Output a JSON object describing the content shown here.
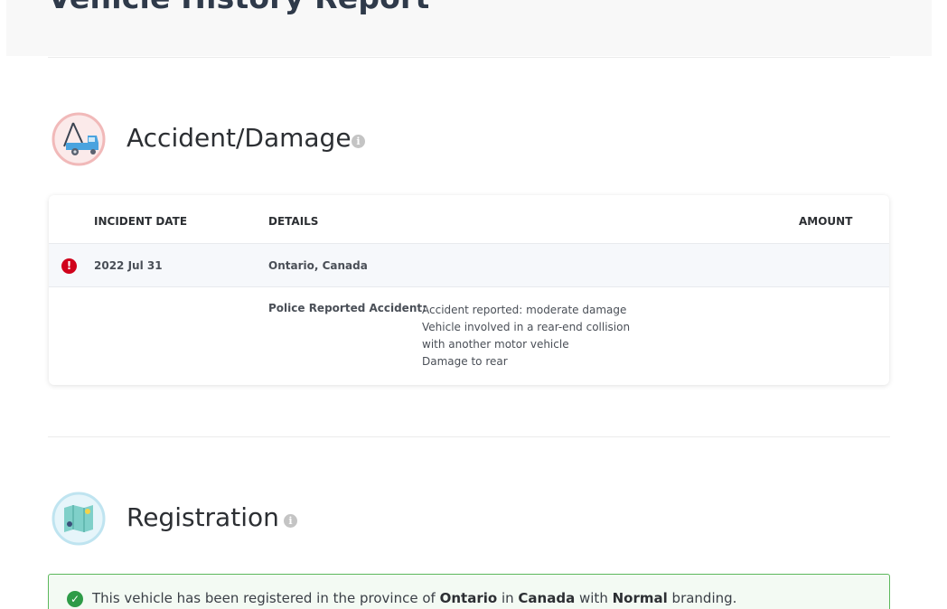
{
  "header": {
    "title": "Vehicle History Report"
  },
  "accident_section": {
    "title": "Accident/Damage",
    "icon": "tow-truck-icon",
    "table": {
      "columns": [
        "INCIDENT DATE",
        "DETAILS",
        "AMOUNT"
      ],
      "rows": [
        {
          "status_icon": "alert-icon",
          "date": "2022 Jul 31",
          "location": "Ontario, Canada",
          "amount": "",
          "detail_label": "Police Reported Accident:",
          "detail_lines": [
            "Accident reported: moderate damage",
            "Vehicle involved in a rear-end collision",
            "with another motor vehicle",
            "Damage to rear"
          ]
        }
      ]
    }
  },
  "registration_section": {
    "title": "Registration",
    "icon": "map-icon",
    "banner": {
      "prefix": "This vehicle has been registered in the province of",
      "province": "Ontario",
      "in_word": "in",
      "country": "Canada",
      "with_word": "with",
      "branding": "Normal",
      "suffix": "branding."
    }
  },
  "colors": {
    "alert": "#d0021b",
    "success": "#2e9b47",
    "success_border": "#5cb85c",
    "info_icon": "#c4c4c4"
  }
}
